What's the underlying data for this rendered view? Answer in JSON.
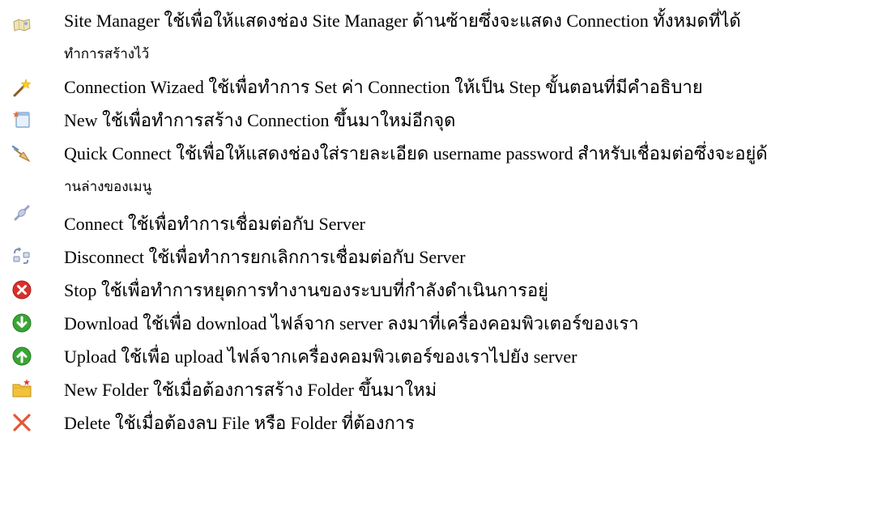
{
  "items": [
    {
      "icon": "site-manager-icon",
      "line1": "Site Manager ใช้เพื่อให้แสดงช่อง Site Manager ด้านซ้ายซึ่งจะแสดง Connection ทั้งหมดที่ได้",
      "line2": "ทำการสร้างไว้"
    },
    {
      "icon": "connection-wizard-icon",
      "line1": "Connection Wizaed ใช้เพื่อทำการ Set ค่า Connection ให้เป็น Step ขั้นตอนที่มีคำอธิบาย"
    },
    {
      "icon": "new-connection-icon",
      "line1": "New ใช้เพื่อทำการสร้าง Connection ขึ้นมาใหม่อีกจุด"
    },
    {
      "icon": "quick-connect-icon",
      "line1": "Quick Connect ใช้เพื่อให้แสดงช่องใส่รายละเอียด username password สำหรับเชื่อมต่อซึ่งจะอยู่ด้",
      "line2": "านล่างของเมนู"
    },
    {
      "icon": "connect-icon",
      "line1": "Connect ใช้เพื่อทำการเชื่อมต่อกับ Server"
    },
    {
      "icon": "disconnect-icon",
      "line1": "Disconnect ใช้เพื่อทำการยกเลิกการเชื่อมต่อกับ Server"
    },
    {
      "icon": "stop-icon",
      "line1": "Stop ใช้เพื่อทำการหยุดการทำงานของระบบที่กำลังดำเนินการอยู่"
    },
    {
      "icon": "download-icon",
      "line1": "Download ใช้เพื่อ download ไฟล์จาก server ลงมาที่เครื่องคอมพิวเตอร์ของเรา"
    },
    {
      "icon": "upload-icon",
      "line1": "Upload ใช้เพื่อ upload ไฟล์จากเครื่องคอมพิวเตอร์ของเราไปยัง server"
    },
    {
      "icon": "new-folder-icon",
      "line1": "New Folder ใช้เมื่อต้องการสร้าง Folder ขึ้นมาใหม่"
    },
    {
      "icon": "delete-icon",
      "line1": "Delete ใช้เมื่อต้องลบ File หรือ Folder ที่ต้องการ"
    }
  ],
  "colors": {
    "stop": "#d9302a",
    "download": "#3aa534",
    "upload": "#3aa534",
    "delete": "#e4573a",
    "folder": "#f2c23c",
    "wand_star": "#f7d11e"
  }
}
